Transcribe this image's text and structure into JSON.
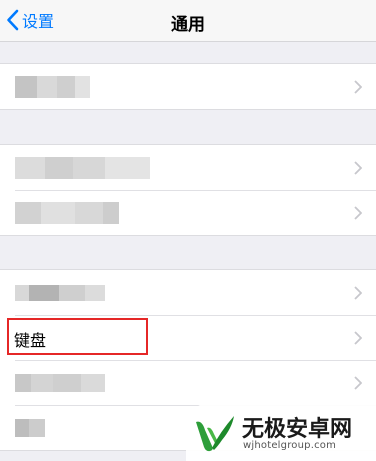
{
  "nav": {
    "back_label": "设置",
    "title": "通用"
  },
  "rows": {
    "keyboard_label": "键盘"
  },
  "watermark": {
    "title": "无极安卓网",
    "url": "wjhotelgroup.com"
  },
  "colors": {
    "accent": "#007aff",
    "highlight": "#e52727",
    "background": "#efeff4"
  }
}
